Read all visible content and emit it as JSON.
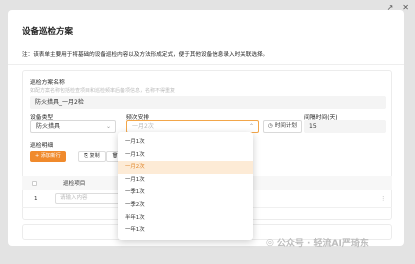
{
  "share": {
    "share_icon": "share-icon",
    "close_icon": "close-icon"
  },
  "header": {
    "title": "设备巡检方案",
    "notice": "注：该表单主要用于将基础的设备巡检内容以及方法形成定式，便于其他设备信息录入时关联选择。"
  },
  "form": {
    "plan_name_label": "巡检方案名称",
    "plan_name_hint": "如配方案名称包括检查项目和巡检频率后备项信息，名称不得重复",
    "plan_name_value": "防火措具_一月2检",
    "device_type_label": "设备类型",
    "device_type_value": "防火措具",
    "frequency_label": "频次安排",
    "frequency_placeholder": "一月2次",
    "time_button": "时间计划",
    "interval_label": "间隔时间(天)",
    "interval_value": "15"
  },
  "details": {
    "label": "巡检明细",
    "add_button": "+ 添加新行",
    "copy_button": "复制",
    "delete_button": "删除"
  },
  "table": {
    "header_item": "巡检项目",
    "rows": [
      {
        "index": "1",
        "placeholder": "请输入内容"
      }
    ]
  },
  "dropdown": {
    "options": [
      "一月1次",
      "一月1次",
      "一月2次",
      "一月1次",
      "一季1次",
      "一季2次",
      "半年1次",
      "一年1次"
    ],
    "selected_index": 2
  },
  "watermark": "公众号 · 轻流AI严琦东"
}
